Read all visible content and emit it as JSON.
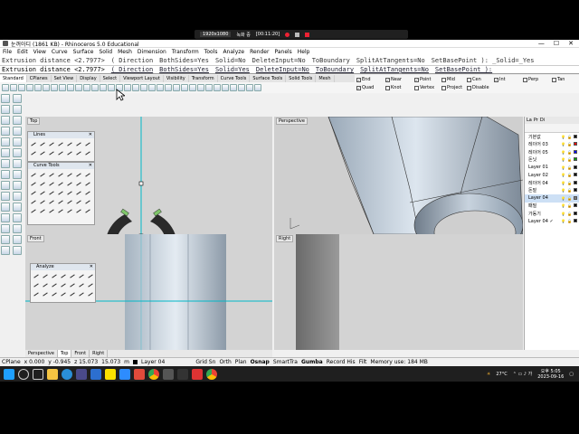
{
  "recorder": {
    "resolution": "1920x1080",
    "status": "녹화 중",
    "time": "[00:11:20]"
  },
  "window": {
    "title": "눈꺼아디 (1861 KB) - Rhinoceros 5.0 Educational",
    "controls": [
      "—",
      "☐",
      "✕"
    ]
  },
  "menu": [
    "File",
    "Edit",
    "View",
    "Curve",
    "Surface",
    "Solid",
    "Mesh",
    "Dimension",
    "Transform",
    "Tools",
    "Analyze",
    "Render",
    "Panels",
    "Help"
  ],
  "command": {
    "history": "Extrusion distance <2.7977>",
    "history_opts": [
      "( Direction",
      "BothSides=Yes",
      "Solid=No",
      "DeleteInput=No",
      "ToBoundary",
      "SplitAtTangents=No",
      "SetBasePoint ): _Solid=_Yes"
    ],
    "prompt": "Extrusion distance <2.7977>",
    "options": [
      "( Direction",
      "BothSides=Yes",
      "Solid=Yes",
      "DeleteInput=No",
      "ToBoundary",
      "SplitAtTangents=No",
      "SetBasePoint ):"
    ]
  },
  "toolbar_tabs": [
    "Standard",
    "CPlanes",
    "Set View",
    "Display",
    "Select",
    "Viewport Layout",
    "Visibility",
    "Transform",
    "Curve Tools",
    "Surface Tools",
    "Solid Tools",
    "Mesh"
  ],
  "osnap": {
    "items": [
      {
        "label": "End",
        "checked": true
      },
      {
        "label": "Near",
        "checked": true
      },
      {
        "label": "Point",
        "checked": true
      },
      {
        "label": "Mid",
        "checked": false
      },
      {
        "label": "Cen",
        "checked": false
      },
      {
        "label": "Int",
        "checked": true
      },
      {
        "label": "Perp",
        "checked": false
      },
      {
        "label": "Tan",
        "checked": false
      },
      {
        "label": "Quad",
        "checked": true
      },
      {
        "label": "Knot",
        "checked": false
      },
      {
        "label": "Vertex",
        "checked": false
      },
      {
        "label": "Project",
        "checked": false
      },
      {
        "label": "Disable",
        "checked": false
      }
    ]
  },
  "viewports": {
    "top": "Top",
    "perspective": "Perspective",
    "front": "Front",
    "right": "Right"
  },
  "panels": {
    "lines": "Lines",
    "curve_tools": "Curve Tools",
    "analyze": "Analyze"
  },
  "layers": {
    "tabs": [
      "La",
      "Pr",
      "Di"
    ],
    "rows": [
      {
        "name": "기본값",
        "color": "#000000"
      },
      {
        "name": "레이어 03",
        "color": "#ff0000"
      },
      {
        "name": "레이어 05",
        "color": "#0000ff"
      },
      {
        "name": "돈닛",
        "color": "#00a000"
      },
      {
        "name": "Layer 01",
        "color": "#000000"
      },
      {
        "name": "Layer 02",
        "color": "#000000"
      },
      {
        "name": "레이어 04",
        "color": "#000000"
      },
      {
        "name": "돈밑",
        "color": "#000000"
      },
      {
        "name": "Layer 04",
        "color": "#808080",
        "selected": true
      },
      {
        "name": "패밀",
        "color": "#000000"
      },
      {
        "name": "가동기",
        "color": "#000000"
      },
      {
        "name": "Layer 04 ✓",
        "color": "#000000"
      }
    ]
  },
  "vp_tabs": [
    "Perspective",
    "Top",
    "Front",
    "Right"
  ],
  "status": {
    "cplane": "CPlane",
    "x": "x 0.000",
    "y": "y -0.945",
    "z": "z 15.073",
    "z2": "15.073",
    "unit": "m",
    "layer": "Layer 04",
    "toggles": [
      "Grid Sn",
      "Orth",
      "Plan",
      "Osnap",
      "SmartTra",
      "Gumba",
      "Record His",
      "Filt",
      "Memory use: 184 MB"
    ]
  },
  "taskbar": {
    "weather": "27°C",
    "time": "오후 5:05",
    "date": "2023-09-16"
  },
  "colors": {
    "cyan_axis": "#00b8c8",
    "red_axis": "#c03030",
    "panel_head": "#dfe6ee",
    "select": "#cde0f5",
    "taskbar": "#1f1f1f"
  }
}
